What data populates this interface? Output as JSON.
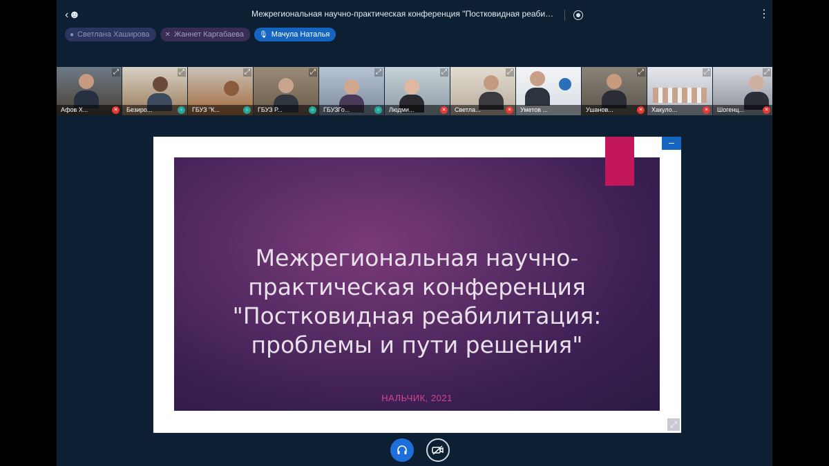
{
  "header": {
    "title": "Межрегиональная научно-практическая конференция \"Постковидная реабилитац...",
    "back_icon": "user-back-icon",
    "record_icon": "record-icon",
    "menu_icon": "kebab-menu-icon"
  },
  "talkers": [
    {
      "name": "Светлана Хаширова",
      "state": "off"
    },
    {
      "name": "Жаннет Каргабаева",
      "state": "muted"
    },
    {
      "name": "Мачула Наталья",
      "state": "speaking"
    }
  ],
  "participants": [
    {
      "name": "Афов Х...",
      "mic": "muted"
    },
    {
      "name": "Безиро...",
      "mic": "listen"
    },
    {
      "name": "ГБУЗ \"К...",
      "mic": "listen"
    },
    {
      "name": "ГБУЗ Р...",
      "mic": "listen"
    },
    {
      "name": "ГБУЗГо...",
      "mic": "listen"
    },
    {
      "name": "Людми...",
      "mic": "muted"
    },
    {
      "name": "Светла...",
      "mic": "muted"
    },
    {
      "name": "Уметов ...",
      "mic": "none"
    },
    {
      "name": "Ушанов...",
      "mic": "muted"
    },
    {
      "name": "Хакуло...",
      "mic": "muted"
    },
    {
      "name": "Шогенц...",
      "mic": "muted"
    }
  ],
  "slide": {
    "title": "Межрегиональная научно-практическая конференция \"Постковидная реабилитация: проблемы и пути решения\"",
    "subtitle": "НАЛЬЧИК, 2021"
  },
  "controls": {
    "audio_icon": "headphones-icon",
    "video_icon": "camera-off-icon"
  },
  "colors": {
    "app_bg": "#0d1f33",
    "accent_blue": "#1565c0",
    "slide_accent": "#c2185b",
    "subtitle_pink": "#d8448c"
  }
}
